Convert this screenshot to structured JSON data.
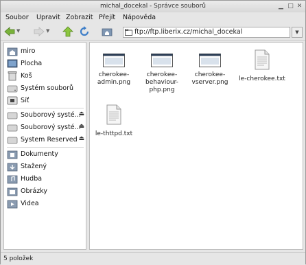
{
  "window": {
    "title": "michal_docekal - Správce souborů"
  },
  "menu": [
    "Soubor",
    "Upravit",
    "Zobrazit",
    "Přejít",
    "Nápověda"
  ],
  "address": {
    "value": "ftp://ftp.liberix.cz/michal_docekal"
  },
  "sidebar": {
    "items": [
      {
        "label": "miro",
        "icon": "home-icon"
      },
      {
        "label": "Plocha",
        "icon": "desktop-icon"
      },
      {
        "label": "Koš",
        "icon": "trash-icon"
      },
      {
        "label": "Systém souborů",
        "icon": "harddisk-icon"
      },
      {
        "label": "Síť",
        "icon": "network-icon"
      },
      {
        "label": "Souborový systé...",
        "icon": "drive-icon",
        "eject": "⏏"
      },
      {
        "label": "Souborový systé...",
        "icon": "drive-icon",
        "eject": "⏏"
      },
      {
        "label": "System Reserved",
        "icon": "drive-icon",
        "eject": "⏏"
      },
      {
        "label": "Dokumenty",
        "icon": "documents-folder-icon"
      },
      {
        "label": "Stažený",
        "icon": "downloads-folder-icon"
      },
      {
        "label": "Hudba",
        "icon": "music-folder-icon"
      },
      {
        "label": "Obrázky",
        "icon": "pictures-folder-icon"
      },
      {
        "label": "Videa",
        "icon": "videos-folder-icon"
      }
    ]
  },
  "files": [
    {
      "name": "cherokee-admin.png",
      "lines": [
        "cherokee-",
        "admin.png"
      ],
      "type": "image"
    },
    {
      "name": "cherokee-behaviour-php.png",
      "lines": [
        "cherokee-",
        "behaviour-",
        "php.png"
      ],
      "type": "image"
    },
    {
      "name": "cherokee-vserver.png",
      "lines": [
        "cherokee-",
        "vserver.png"
      ],
      "type": "image"
    },
    {
      "name": "le-cherokee.txt",
      "lines": [
        "le-cherokee.txt"
      ],
      "type": "text"
    },
    {
      "name": "le-thttpd.txt",
      "lines": [
        "le-thttpd.txt"
      ],
      "type": "text"
    }
  ],
  "status": {
    "text": "5 položek"
  },
  "colors": {
    "folder": "#8a9bb0",
    "accent": "#3d7ec8",
    "up_arrow": "#6aa84f"
  }
}
